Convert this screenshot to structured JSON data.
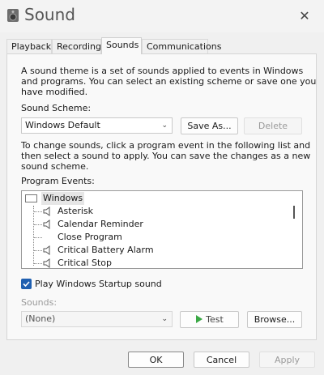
{
  "window": {
    "title": "Sound"
  },
  "tabs": [
    {
      "label": "Playback"
    },
    {
      "label": "Recording"
    },
    {
      "label": "Sounds"
    },
    {
      "label": "Communications"
    }
  ],
  "sounds": {
    "intro": [
      "A sound theme is a set of sounds applied to events in Windows",
      "and programs.  You can select an existing scheme or save one you",
      "have modified."
    ],
    "scheme_label": "Sound Scheme:",
    "scheme_value": "Windows Default",
    "save_as_label": "Save As...",
    "delete_label": "Delete",
    "instructions": [
      "To change sounds, click a program event in the following list and",
      "then select a sound to apply.  You can save the changes as a new",
      "sound scheme."
    ],
    "events_label": "Program Events:",
    "events": [
      {
        "label": "Windows"
      },
      {
        "label": "Asterisk"
      },
      {
        "label": "Calendar Reminder"
      },
      {
        "label": "Close Program"
      },
      {
        "label": "Critical Battery Alarm"
      },
      {
        "label": "Critical Stop"
      }
    ],
    "startup_label": "Play Windows Startup sound",
    "startup_checked": true,
    "sounds_label": "Sounds:",
    "sound_value": "(None)",
    "test_label": "Test",
    "browse_label": "Browse..."
  },
  "footer": {
    "ok_label": "OK",
    "cancel_label": "Cancel",
    "apply_label": "Apply"
  },
  "colors": {
    "accent": "#1f5fb0",
    "test_arrow": "#3aa845"
  }
}
